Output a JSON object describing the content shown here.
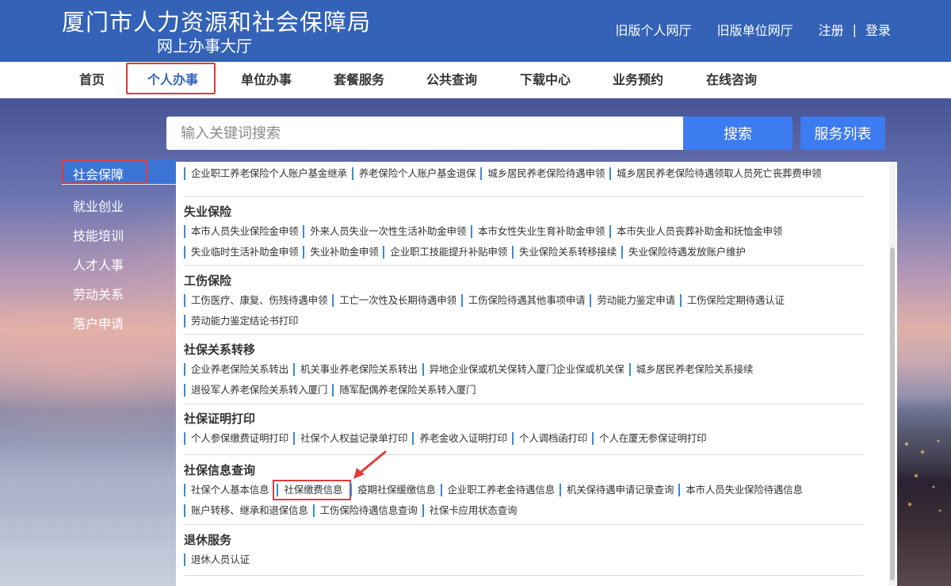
{
  "header": {
    "title": "厦门市人力资源和社会保障局",
    "subtitle": "网上办事大厅",
    "links": {
      "old_personal": "旧版个人网厅",
      "old_unit": "旧版单位网厅",
      "register": "注册",
      "separator": "|",
      "login": "登录"
    }
  },
  "nav": {
    "items": [
      "首页",
      "个人办事",
      "单位办事",
      "套餐服务",
      "公共查询",
      "下载中心",
      "业务预约",
      "在线咨询"
    ],
    "active": "个人办事"
  },
  "search": {
    "placeholder": "输入关键词搜索",
    "button": "搜索",
    "list_button": "服务列表"
  },
  "sidebar": {
    "items": [
      "社会保障",
      "就业创业",
      "技能培训",
      "人才人事",
      "劳动关系",
      "落户申请"
    ],
    "active": "社会保障"
  },
  "sections": [
    {
      "title": "",
      "rows": [
        [
          "企业职工养老保险个人账户基金继承",
          "养老保险个人账户基金退保",
          "城乡居民养老保险待遇申领",
          "城乡居民养老保险待遇领取人员死亡丧葬费申领"
        ]
      ]
    },
    {
      "title": "失业保险",
      "rows": [
        [
          "本市人员失业保险金申领",
          "外来人员失业一次性生活补助金申领",
          "本市女性失业生育补助金申领",
          "本市失业人员丧葬补助金和抚恤金申领"
        ],
        [
          "失业临时生活补助金申领",
          "失业补助金申领",
          "企业职工技能提升补贴申领",
          "失业保险关系转移接续",
          "失业保险待遇发放账户维护"
        ]
      ]
    },
    {
      "title": "工伤保险",
      "rows": [
        [
          "工伤医疗、康复、伤残待遇申领",
          "工亡一次性及长期待遇申领",
          "工伤保险待遇其他事项申请",
          "劳动能力鉴定申请",
          "工伤保险定期待遇认证"
        ],
        [
          "劳动能力鉴定结论书打印"
        ]
      ]
    },
    {
      "title": "社保关系转移",
      "rows": [
        [
          "企业养老保险关系转出",
          "机关事业养老保险关系转出",
          "异地企业保或机关保转入厦门企业保或机关保",
          "城乡居民养老保险关系接续"
        ],
        [
          "退役军人养老保险关系转入厦门",
          "随军配偶养老保险关系转入厦门"
        ]
      ]
    },
    {
      "title": "社保证明打印",
      "rows": [
        [
          "个人参保缴费证明打印",
          "社保个人权益记录单打印",
          "养老金收入证明打印",
          "个人调档函打印",
          "个人在厦无参保证明打印"
        ]
      ]
    },
    {
      "title": "社保信息查询",
      "rows": [
        [
          "社保个人基本信息",
          "社保缴费信息",
          "疫期社保缓缴信息",
          "企业职工养老金待遇信息",
          "机关保待遇申请记录查询",
          "本市人员失业保险待遇信息"
        ],
        [
          "账户转移、继承和退保信息",
          "工伤保险待遇信息查询",
          "社保卡应用状态查询"
        ]
      ],
      "highlighted": "社保缴费信息"
    },
    {
      "title": "退休服务",
      "rows": [
        [
          "退休人员认证"
        ]
      ]
    }
  ],
  "colors": {
    "header_bg": "#3362b7",
    "accent": "#3c7cf0",
    "highlight": "#e03b3b",
    "item_bar": "#3a8ad8"
  }
}
